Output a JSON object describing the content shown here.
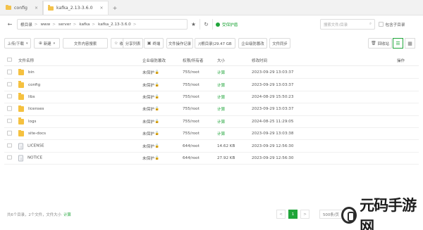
{
  "tabs": [
    {
      "label": "config",
      "active": false
    },
    {
      "label": "kafka_2.13-3.6.0",
      "active": true
    }
  ],
  "tab_close": "×",
  "tab_add": "+",
  "address": {
    "back": "←",
    "crumbs": [
      "根目录",
      "www",
      "server",
      "kafka",
      "kafka_2.13-3.6.0"
    ],
    "separator": ">",
    "star": "★",
    "refresh": "↻",
    "recycle_label": "受保护盾",
    "search_placeholder": "搜索文件/目录",
    "search_icon": "⌕",
    "subdir_label": "包含子目录"
  },
  "toolbar": {
    "upload": "上传/下载",
    "new": "新建",
    "content_search": "文件内容搜索",
    "favorites": "收藏夹",
    "share_list": "分享列表",
    "terminal": "终端",
    "file_log": "文件操作记录",
    "disk": "/(根目录)29.47 GB",
    "enterprise": "企业级防篡改",
    "sync": "文件同步",
    "recycle_bin": "回收站"
  },
  "columns": {
    "name": "文件名称",
    "protect": "企业级防篡改",
    "perm": "权限/所有者",
    "size": "大小",
    "mtime": "修改时间",
    "ops": "操作"
  },
  "rows": [
    {
      "name": "bin",
      "type": "folder",
      "protect": "未保护",
      "perm": "755/root",
      "size": "计算",
      "mtime": "2023-09-29 13:03:37"
    },
    {
      "name": "config",
      "type": "folder",
      "protect": "未保护",
      "perm": "755/root",
      "size": "计算",
      "mtime": "2023-09-29 13:03:37"
    },
    {
      "name": "libs",
      "type": "folder",
      "protect": "未保护",
      "perm": "755/root",
      "size": "计算",
      "mtime": "2024-08-29 15:50:23"
    },
    {
      "name": "licenses",
      "type": "folder",
      "protect": "未保护",
      "perm": "755/root",
      "size": "计算",
      "mtime": "2023-09-29 13:03:37"
    },
    {
      "name": "logs",
      "type": "folder",
      "protect": "未保护",
      "perm": "755/root",
      "size": "计算",
      "mtime": "2024-08-25 11:29:05"
    },
    {
      "name": "site-docs",
      "type": "folder",
      "protect": "未保护",
      "perm": "755/root",
      "size": "计算",
      "mtime": "2023-09-29 13:03:38"
    },
    {
      "name": "LICENSE",
      "type": "file",
      "protect": "未保护",
      "perm": "644/root",
      "size": "14.62 KB",
      "mtime": "2023-09-29 12:56:30"
    },
    {
      "name": "NOTICE",
      "type": "file",
      "protect": "未保护",
      "perm": "644/root",
      "size": "27.92 KB",
      "mtime": "2023-09-29 12:56:30"
    }
  ],
  "footer": {
    "summary": "共6个目录，2个文件，文件大小",
    "calc": "计算",
    "prev": "<",
    "page": "1",
    "next": ">",
    "per_page": "500条/页"
  },
  "watermark": "元码手游网",
  "colors": {
    "accent": "#20a53a",
    "folder": "#f5c140"
  }
}
